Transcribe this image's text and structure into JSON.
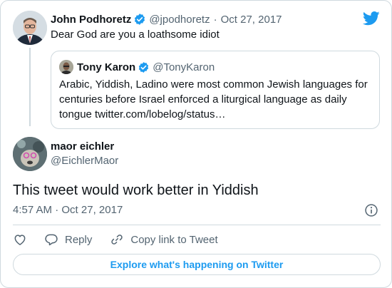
{
  "parent_tweet": {
    "author_name": "John Podhoretz",
    "handle": "@jpodhoretz",
    "separator": "·",
    "date": "Oct 27, 2017",
    "text": "Dear God are you a loathsome idiot"
  },
  "quoted_tweet": {
    "author_name": "Tony Karon",
    "handle": "@TonyKaron",
    "text": "Arabic, Yiddish, Ladino were most common Jewish languages for centuries before Israel enforced a liturgical language as daily tongue twitter.com/lobelog/status…"
  },
  "main_tweet": {
    "author_name": "maor eichler",
    "handle": "@EichlerMaor",
    "text": "This tweet would work better in Yiddish",
    "time": "4:57 AM",
    "separator": "·",
    "date": "Oct 27, 2017"
  },
  "actions": {
    "reply_label": "Reply",
    "copy_link_label": "Copy link to Tweet"
  },
  "explore_button": {
    "label": "Explore what's happening on Twitter"
  },
  "icons": {
    "like": "heart-icon",
    "reply": "speech-bubble-icon",
    "copy_link": "link-icon",
    "info": "info-icon",
    "brand": "twitter-bird-icon",
    "verified": "verified-badge-icon"
  },
  "colors": {
    "accent": "#1d9bf0",
    "text": "#0f1419",
    "muted": "#536471",
    "border": "#cfd9de"
  }
}
